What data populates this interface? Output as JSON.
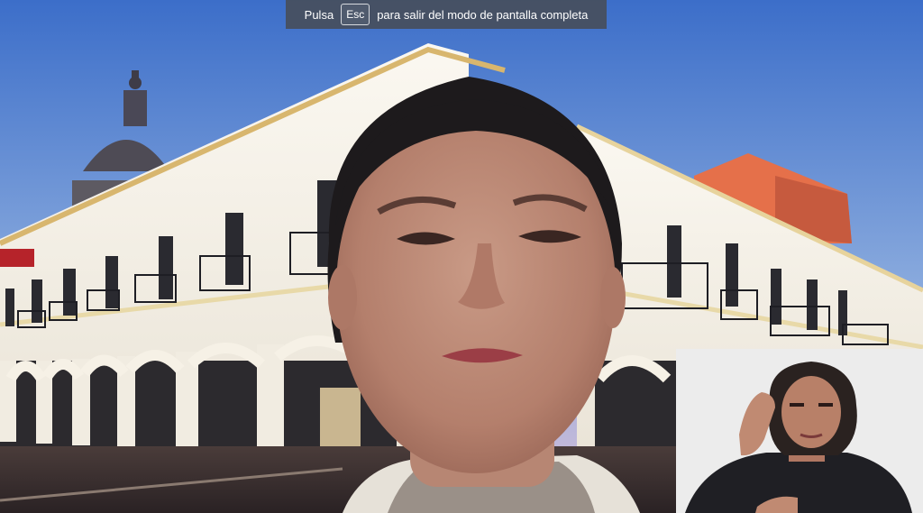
{
  "fullscreen_notice": {
    "prefix": "Pulsa",
    "key": "Esc",
    "suffix": "para salir del modo de pantalla completa"
  },
  "colors": {
    "sky_top": "#3f6fc8",
    "sky_bottom": "#c9b8d8",
    "building_wall": "#f4f1ea",
    "banner_bg": "#464e5c"
  },
  "icons": {
    "main_video": "presenter-video",
    "interpreter_video": "sign-language-interpreter-video"
  }
}
